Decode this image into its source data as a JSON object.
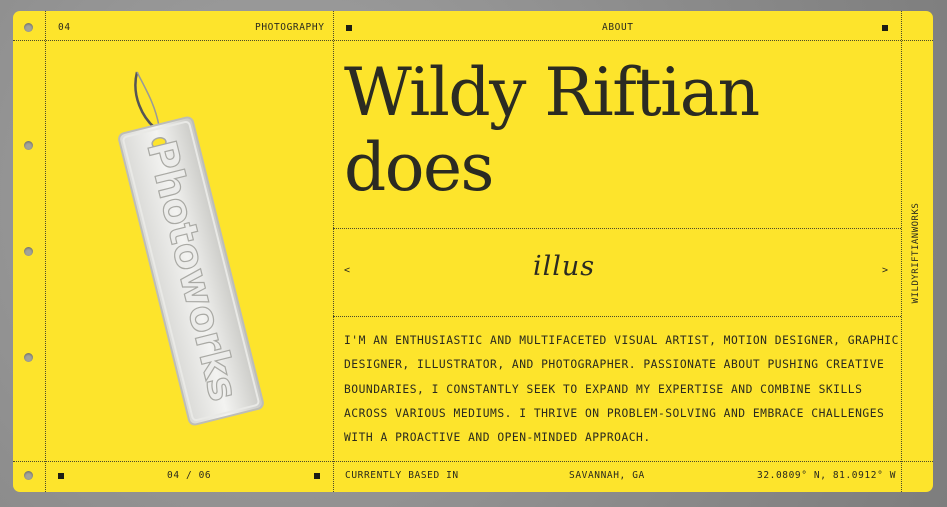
{
  "header": {
    "index": "04",
    "section": "PHOTOGRAPHY",
    "about": "ABOUT"
  },
  "headline": {
    "line1": "Wildy Riftian",
    "line2": "does"
  },
  "carousel": {
    "word": "illus",
    "prev": "<",
    "next": ">"
  },
  "bio": "I'M AN ENTHUSIASTIC AND MULTIFACETED VISUAL ARTIST, MOTION DESIGNER, GRAPHIC DESIGNER, ILLUSTRATOR, AND PHOTOGRAPHER. PASSIONATE ABOUT PUSHING CREATIVE BOUNDARIES, I CONSTANTLY SEEK TO EXPAND MY EXPERTISE AND COMBINE SKILLS ACROSS VARIOUS MEDIUMS. I THRIVE ON PROBLEM-SOLVING AND EMBRACE CHALLENGES WITH A PROACTIVE AND OPEN-MINDED APPROACH.",
  "sidebar": {
    "vertical_label": "WILDYRIFTIANWORKS"
  },
  "image": {
    "tag_text": "Photoworks"
  },
  "footer": {
    "pagination": "04 / 06",
    "location_label": "CURRENTLY BASED IN",
    "location": "SAVANNAH, GA",
    "coordinates": "32.0809° N, 81.0912° W"
  },
  "colors": {
    "card": "#fde42c",
    "ink": "#2a2a1e",
    "background": "#8f8f8f"
  }
}
